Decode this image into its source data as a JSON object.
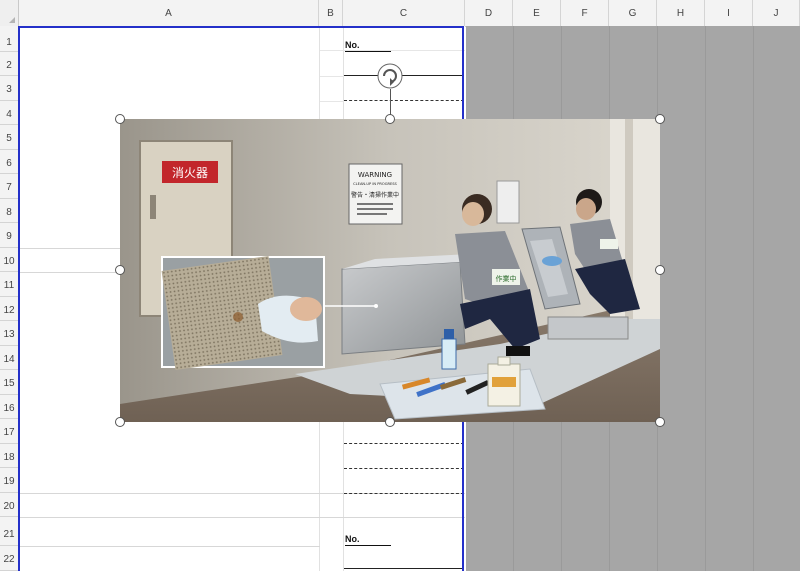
{
  "column_headers": [
    "A",
    "B",
    "C",
    "D",
    "E",
    "F",
    "G",
    "H",
    "I",
    "J"
  ],
  "row_headers": [
    "1",
    "2",
    "3",
    "4",
    "5",
    "6",
    "7",
    "8",
    "9",
    "10",
    "11",
    "12",
    "13",
    "14",
    "15",
    "16",
    "17",
    "18",
    "19",
    "20",
    "21",
    "22"
  ],
  "cells": {
    "c1_label": "No.",
    "c21_label": "No."
  },
  "photo": {
    "sign_fire": "消火器",
    "sign_warning_title": "WARNING",
    "sign_warning_sub": "CLEAN-UP IN PROGRESS",
    "sign_warning_jp": "警告・清掃作業中",
    "badge": "作業中"
  },
  "colors": {
    "print_area_border": "#2430c9",
    "gray_area": "#a6a6a6"
  },
  "icons": [
    "rotate-handle-icon",
    "resize-handle-icon"
  ]
}
